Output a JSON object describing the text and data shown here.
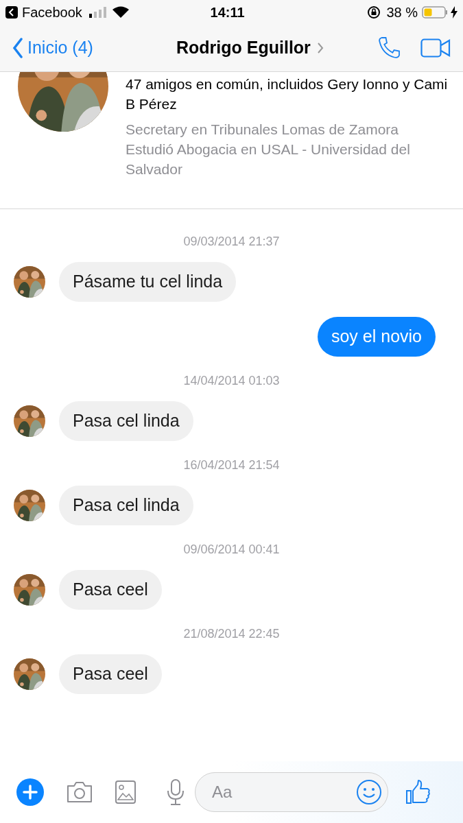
{
  "status_bar": {
    "back_app": "Facebook",
    "time": "14:11",
    "battery": "38 %"
  },
  "nav": {
    "back": "Inicio (4)",
    "title": "Rodrigo Eguillor"
  },
  "profile": {
    "mutual": "47 amigos en común, incluidos Gery Ionno y Cami B Pérez",
    "details": [
      "Secretary en Tribunales Lomas de Zamora",
      "Estudió Abogacia en USAL - Universidad del Salvador"
    ]
  },
  "messages": [
    {
      "kind": "timestamp",
      "text": "09/03/2014 21:37"
    },
    {
      "kind": "incoming",
      "text": "Pásame tu cel linda"
    },
    {
      "kind": "outgoing",
      "text": "soy el novio"
    },
    {
      "kind": "timestamp",
      "text": "14/04/2014 01:03"
    },
    {
      "kind": "incoming",
      "text": "Pasa cel linda"
    },
    {
      "kind": "timestamp",
      "text": "16/04/2014 21:54"
    },
    {
      "kind": "incoming",
      "text": "Pasa cel linda"
    },
    {
      "kind": "timestamp",
      "text": "09/06/2014 00:41"
    },
    {
      "kind": "incoming",
      "text": "Pasa ceel"
    },
    {
      "kind": "timestamp",
      "text": "21/08/2014 22:45"
    },
    {
      "kind": "incoming",
      "text": "Pasa ceel"
    }
  ],
  "composer": {
    "placeholder": "Aa"
  }
}
